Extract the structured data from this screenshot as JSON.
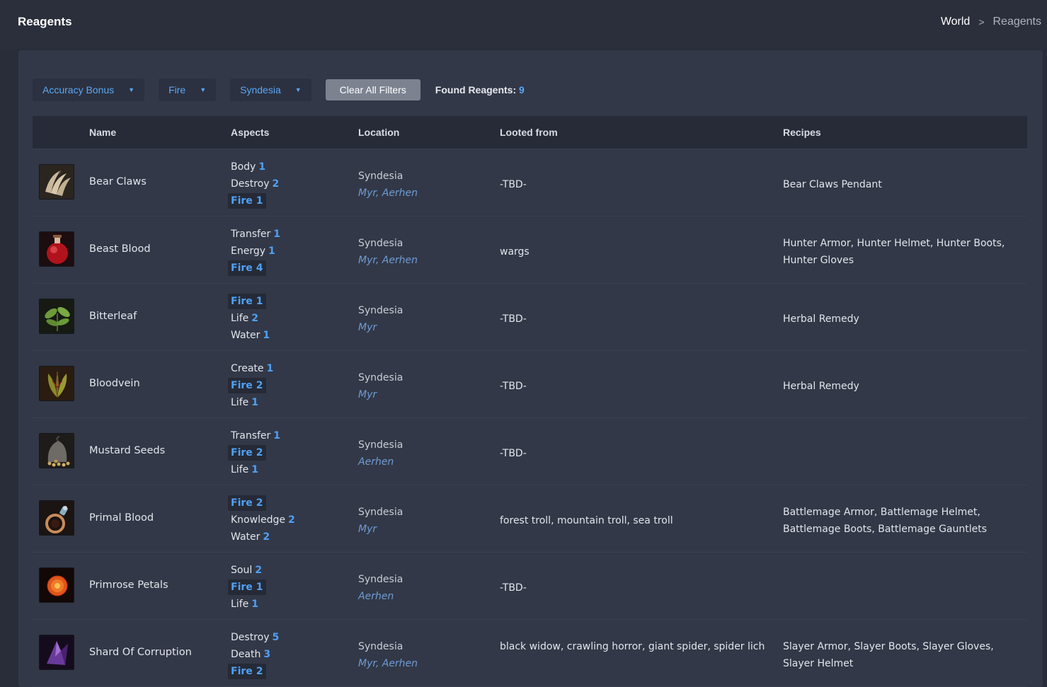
{
  "header": {
    "title": "Reagents",
    "breadcrumb": {
      "world": "World",
      "separator": ">",
      "current": "Reagents"
    }
  },
  "filters": {
    "dropdowns": [
      {
        "label": "Accuracy Bonus"
      },
      {
        "label": "Fire"
      },
      {
        "label": "Syndesia"
      }
    ],
    "clear_label": "Clear All Filters",
    "found_label": "Found Reagents:",
    "found_count": "9"
  },
  "table": {
    "columns": [
      "Name",
      "Aspects",
      "Location",
      "Looted from",
      "Recipes"
    ],
    "rows": [
      {
        "icon": "bear-claws-icon",
        "name": "Bear Claws",
        "aspects": [
          {
            "label": "Body",
            "value": "1",
            "highlight": false
          },
          {
            "label": "Destroy",
            "value": "2",
            "highlight": false
          },
          {
            "label": "Fire",
            "value": "1",
            "highlight": true
          }
        ],
        "location": "Syndesia",
        "sublocation": "Myr, Aerhen",
        "looted": "-TBD-",
        "recipes": "Bear Claws Pendant"
      },
      {
        "icon": "beast-blood-icon",
        "name": "Beast Blood",
        "aspects": [
          {
            "label": "Transfer",
            "value": "1",
            "highlight": false
          },
          {
            "label": "Energy",
            "value": "1",
            "highlight": false
          },
          {
            "label": "Fire",
            "value": "4",
            "highlight": true
          }
        ],
        "location": "Syndesia",
        "sublocation": "Myr, Aerhen",
        "looted": "wargs",
        "recipes": "Hunter Armor, Hunter Helmet, Hunter Boots, Hunter Gloves"
      },
      {
        "icon": "bitterleaf-icon",
        "name": "Bitterleaf",
        "aspects": [
          {
            "label": "Fire",
            "value": "1",
            "highlight": true
          },
          {
            "label": "Life",
            "value": "2",
            "highlight": false
          },
          {
            "label": "Water",
            "value": "1",
            "highlight": false
          }
        ],
        "location": "Syndesia",
        "sublocation": "Myr",
        "looted": "-TBD-",
        "recipes": "Herbal Remedy"
      },
      {
        "icon": "bloodvein-icon",
        "name": "Bloodvein",
        "aspects": [
          {
            "label": "Create",
            "value": "1",
            "highlight": false
          },
          {
            "label": "Fire",
            "value": "2",
            "highlight": true
          },
          {
            "label": "Life",
            "value": "1",
            "highlight": false
          }
        ],
        "location": "Syndesia",
        "sublocation": "Myr",
        "looted": "-TBD-",
        "recipes": "Herbal Remedy"
      },
      {
        "icon": "mustard-seeds-icon",
        "name": "Mustard Seeds",
        "aspects": [
          {
            "label": "Transfer",
            "value": "1",
            "highlight": false
          },
          {
            "label": "Fire",
            "value": "2",
            "highlight": true
          },
          {
            "label": "Life",
            "value": "1",
            "highlight": false
          }
        ],
        "location": "Syndesia",
        "sublocation": "Aerhen",
        "looted": "-TBD-",
        "recipes": ""
      },
      {
        "icon": "primal-blood-icon",
        "name": "Primal Blood",
        "aspects": [
          {
            "label": "Fire",
            "value": "2",
            "highlight": true
          },
          {
            "label": "Knowledge",
            "value": "2",
            "highlight": false
          },
          {
            "label": "Water",
            "value": "2",
            "highlight": false
          }
        ],
        "location": "Syndesia",
        "sublocation": "Myr",
        "looted": "forest troll, mountain troll, sea troll",
        "recipes": "Battlemage Armor, Battlemage Helmet, Battlemage Boots, Battlemage Gauntlets"
      },
      {
        "icon": "primrose-petals-icon",
        "name": "Primrose Petals",
        "aspects": [
          {
            "label": "Soul",
            "value": "2",
            "highlight": false
          },
          {
            "label": "Fire",
            "value": "1",
            "highlight": true
          },
          {
            "label": "Life",
            "value": "1",
            "highlight": false
          }
        ],
        "location": "Syndesia",
        "sublocation": "Aerhen",
        "looted": "-TBD-",
        "recipes": ""
      },
      {
        "icon": "shard-of-corruption-icon",
        "name": "Shard Of Corruption",
        "aspects": [
          {
            "label": "Destroy",
            "value": "5",
            "highlight": false
          },
          {
            "label": "Death",
            "value": "3",
            "highlight": false
          },
          {
            "label": "Fire",
            "value": "2",
            "highlight": true
          }
        ],
        "location": "Syndesia",
        "sublocation": "Myr, Aerhen",
        "looted": "black widow, crawling horror, giant spider, spider lich",
        "recipes": "Slayer Armor, Slayer Boots, Slayer Gloves, Slayer Helmet"
      }
    ]
  },
  "colors": {
    "background": "#282d39",
    "card": "#323847",
    "accent": "#4fa0f5",
    "table_header": "#262b37"
  }
}
